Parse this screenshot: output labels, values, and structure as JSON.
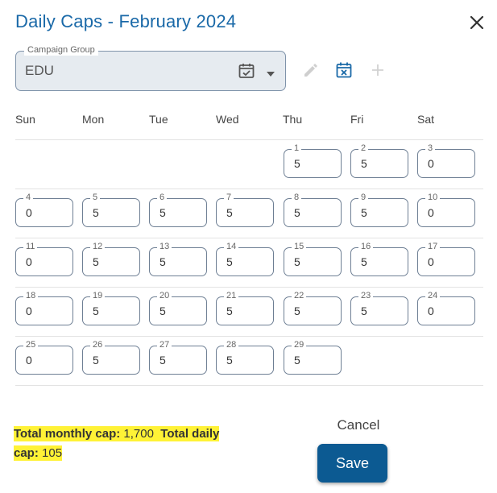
{
  "dialog": {
    "title": "Daily Caps - February 2024"
  },
  "campaign_group": {
    "label": "Campaign Group",
    "value": "EDU"
  },
  "weekdays": [
    "Sun",
    "Mon",
    "Tue",
    "Wed",
    "Thu",
    "Fri",
    "Sat"
  ],
  "weeks": [
    [
      null,
      null,
      null,
      null,
      {
        "day": "1",
        "cap": "5"
      },
      {
        "day": "2",
        "cap": "5"
      },
      {
        "day": "3",
        "cap": "0"
      }
    ],
    [
      {
        "day": "4",
        "cap": "0"
      },
      {
        "day": "5",
        "cap": "5"
      },
      {
        "day": "6",
        "cap": "5"
      },
      {
        "day": "7",
        "cap": "5"
      },
      {
        "day": "8",
        "cap": "5"
      },
      {
        "day": "9",
        "cap": "5"
      },
      {
        "day": "10",
        "cap": "0"
      }
    ],
    [
      {
        "day": "11",
        "cap": "0"
      },
      {
        "day": "12",
        "cap": "5"
      },
      {
        "day": "13",
        "cap": "5"
      },
      {
        "day": "14",
        "cap": "5"
      },
      {
        "day": "15",
        "cap": "5"
      },
      {
        "day": "16",
        "cap": "5"
      },
      {
        "day": "17",
        "cap": "0"
      }
    ],
    [
      {
        "day": "18",
        "cap": "0"
      },
      {
        "day": "19",
        "cap": "5"
      },
      {
        "day": "20",
        "cap": "5"
      },
      {
        "day": "21",
        "cap": "5"
      },
      {
        "day": "22",
        "cap": "5"
      },
      {
        "day": "23",
        "cap": "5"
      },
      {
        "day": "24",
        "cap": "0"
      }
    ],
    [
      {
        "day": "25",
        "cap": "0"
      },
      {
        "day": "26",
        "cap": "5"
      },
      {
        "day": "27",
        "cap": "5"
      },
      {
        "day": "28",
        "cap": "5"
      },
      {
        "day": "29",
        "cap": "5"
      },
      null,
      null
    ]
  ],
  "summary": {
    "monthly_label": "Total monthly cap:",
    "monthly_value": "1,700",
    "daily_label": "Total daily cap:",
    "daily_value": "105"
  },
  "actions": {
    "cancel": "Cancel",
    "save": "Save"
  },
  "colors": {
    "title": "#1a69a8",
    "save_bg": "#0c5a92",
    "highlight": "#fff236",
    "calendar_icon": "#1a69a8"
  }
}
